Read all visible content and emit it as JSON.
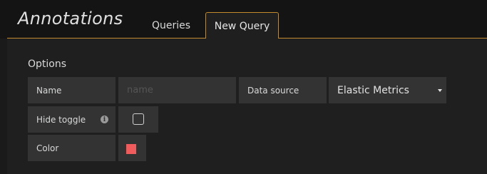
{
  "header": {
    "title": "Annotations",
    "tabs": [
      {
        "label": "Queries",
        "active": false
      },
      {
        "label": "New Query",
        "active": true
      }
    ],
    "accent_color": "#c48a2e"
  },
  "options": {
    "section_title": "Options",
    "name": {
      "label": "Name",
      "value": "",
      "placeholder": "name"
    },
    "data_source": {
      "label": "Data source",
      "selected": "Elastic Metrics"
    },
    "hide_toggle": {
      "label": "Hide toggle",
      "info_icon": "info-icon",
      "checked": false
    },
    "color": {
      "label": "Color",
      "value": "#f15b5b"
    }
  }
}
